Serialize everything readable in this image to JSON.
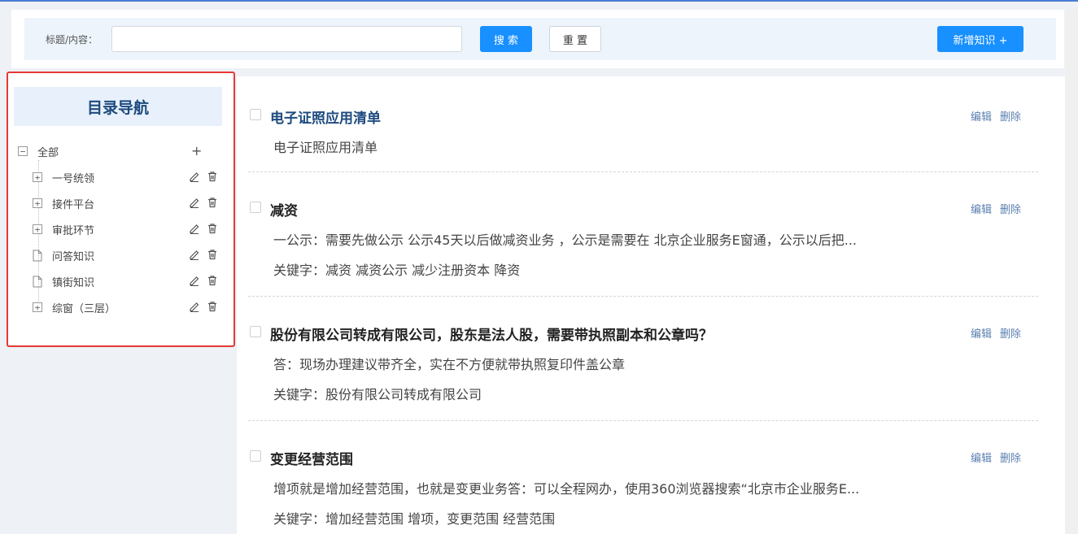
{
  "search": {
    "label": "标题/内容：",
    "value": "",
    "placeholder": "",
    "search_button": "搜 索",
    "reset_button": "重 置",
    "add_button": "新增知识 +"
  },
  "sidebar": {
    "title": "目录导航",
    "root": {
      "label": "全部",
      "toggle": "−",
      "add": "+"
    },
    "items": [
      {
        "label": "一号统领",
        "type": "folder",
        "toggle": "+"
      },
      {
        "label": "接件平台",
        "type": "folder",
        "toggle": "+"
      },
      {
        "label": "审批环节",
        "type": "folder",
        "toggle": "+"
      },
      {
        "label": "问答知识",
        "type": "file"
      },
      {
        "label": "镇街知识",
        "type": "file"
      },
      {
        "label": "综窗（三层）",
        "type": "folder",
        "toggle": "+"
      }
    ]
  },
  "entries": [
    {
      "title": "电子证照应用清单",
      "lines": [
        "电子证照应用清单"
      ],
      "edit": "编辑",
      "delete": "删除"
    },
    {
      "title": "减资",
      "lines": [
        "一公示：需要先做公示  公示45天以后做减资业务 ，公示是需要在 北京企业服务E窗通，公示以后把...",
        "关键字：减资 减资公示 减少注册资本 降资"
      ],
      "edit": "编辑",
      "delete": "删除"
    },
    {
      "title": "股份有限公司转成有限公司，股东是法人股，需要带执照副本和公章吗？",
      "lines": [
        "答：现场办理建议带齐全，实在不方便就带执照复印件盖公章",
        "关键字：股份有限公司转成有限公司"
      ],
      "edit": "编辑",
      "delete": "删除"
    },
    {
      "title": "变更经营范围",
      "lines": [
        "增项就是增加经营范围，也就是变更业务答：可以全程网办，使用360浏览器搜索“北京市企业服务E...",
        "关键字：增加经营范围 增项，变更范围 经营范围"
      ],
      "edit": "编辑",
      "delete": "删除"
    }
  ],
  "colors": {
    "primary": "#1890ff",
    "highlight_border": "#e53935",
    "title_link": "#1d4a7e",
    "action_link": "#5a7fb0"
  }
}
